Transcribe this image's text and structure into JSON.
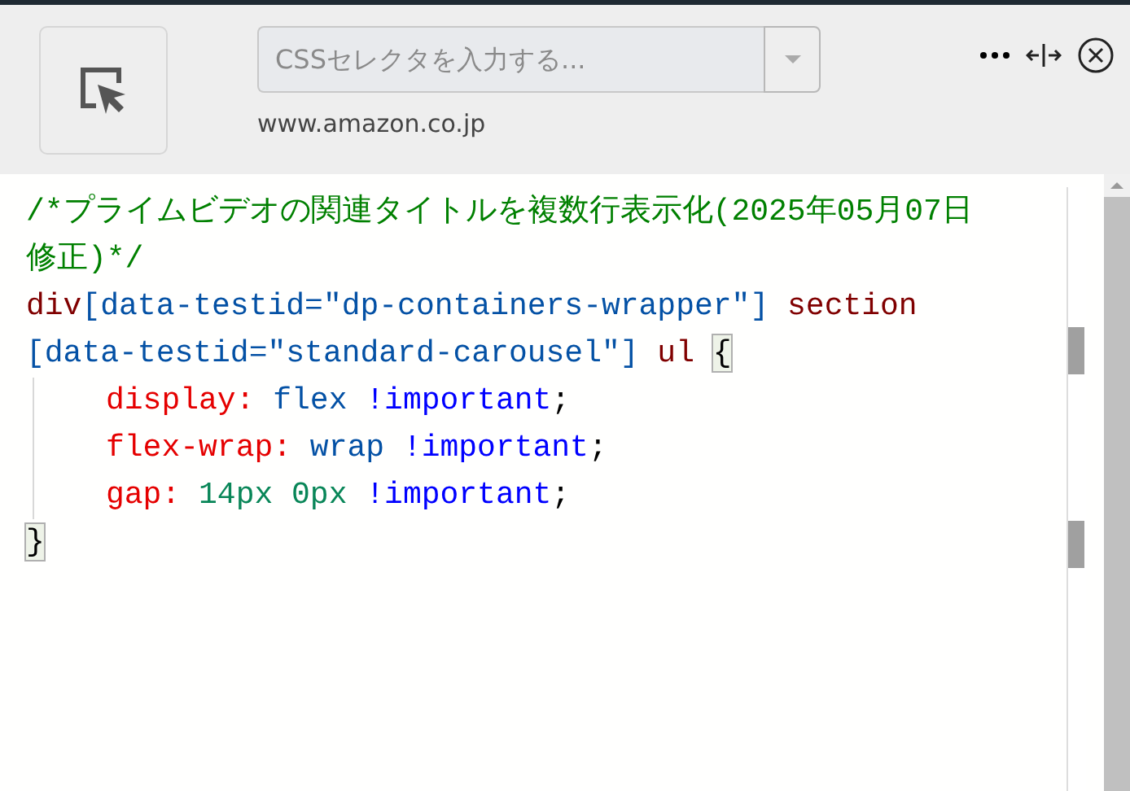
{
  "toolbar": {
    "selector_field": {
      "placeholder": "CSSセレクタを入力する..."
    },
    "site": "www.amazon.co.jp"
  },
  "editor": {
    "lines": [
      {
        "indent": false,
        "tokens": [
          {
            "kind": "comment",
            "text": "/*プライムビデオの関連タイトルを複数行表示化(2025年05月07日"
          }
        ]
      },
      {
        "indent": false,
        "tokens": [
          {
            "kind": "comment",
            "text": "修正)*/"
          }
        ]
      },
      {
        "indent": false,
        "tokens": [
          {
            "kind": "tag",
            "text": "div"
          },
          {
            "kind": "attr",
            "text": "[data-testid="
          },
          {
            "kind": "string",
            "text": "\"dp-containers-wrapper\""
          },
          {
            "kind": "attr",
            "text": "]"
          },
          {
            "kind": "tag",
            "text": " section"
          }
        ]
      },
      {
        "indent": false,
        "tokens": [
          {
            "kind": "attr",
            "text": "[data-testid="
          },
          {
            "kind": "string",
            "text": "\"standard-carousel\""
          },
          {
            "kind": "attr",
            "text": "]"
          },
          {
            "kind": "tag",
            "text": " ul "
          },
          {
            "kind": "bracket",
            "text": "{"
          }
        ]
      },
      {
        "indent": true,
        "tokens": [
          {
            "kind": "prop",
            "text": "display: "
          },
          {
            "kind": "value",
            "text": "flex "
          },
          {
            "kind": "important",
            "text": "!important"
          },
          {
            "kind": "punct",
            "text": ";"
          }
        ]
      },
      {
        "indent": true,
        "tokens": [
          {
            "kind": "prop",
            "text": "flex-wrap: "
          },
          {
            "kind": "value",
            "text": "wrap "
          },
          {
            "kind": "important",
            "text": "!important"
          },
          {
            "kind": "punct",
            "text": ";"
          }
        ]
      },
      {
        "indent": true,
        "tokens": [
          {
            "kind": "prop",
            "text": "gap: "
          },
          {
            "kind": "number",
            "text": "14px 0px "
          },
          {
            "kind": "important",
            "text": "!important"
          },
          {
            "kind": "punct",
            "text": ";"
          }
        ]
      },
      {
        "indent": false,
        "tokens": [
          {
            "kind": "bracket",
            "text": "}"
          }
        ]
      }
    ]
  }
}
